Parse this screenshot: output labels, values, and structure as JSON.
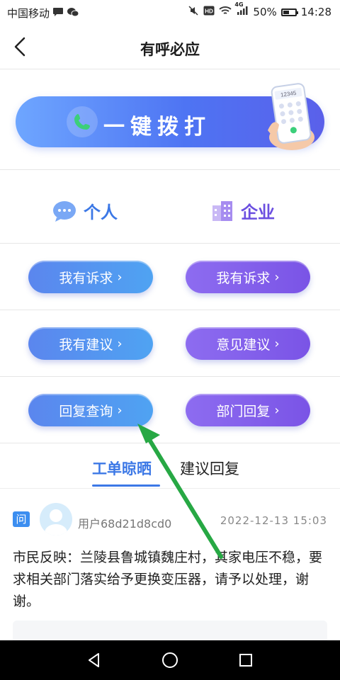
{
  "status_bar": {
    "carrier": "中国移动",
    "network": "4G",
    "battery": "50%",
    "battery_level": 0.5,
    "time": "14:28"
  },
  "header": {
    "title": "有呼必应"
  },
  "banner": {
    "label": "一键拨打",
    "phone_screen_text": "12345"
  },
  "categories": {
    "personal": "个人",
    "enterprise": "企业"
  },
  "buttons": {
    "row1": {
      "left": "我有诉求",
      "right": "我有诉求"
    },
    "row2": {
      "left": "我有建议",
      "right": "意见建议"
    },
    "row3": {
      "left": "回复查询",
      "right": "部门回复"
    },
    "chevron": "›"
  },
  "tabs": {
    "active": "工单晾晒",
    "inactive": "建议回复"
  },
  "post": {
    "badge": "问",
    "username": "用户68d21d8cd0",
    "timestamp": "2022-12-13 15:03",
    "body": "市民反映：兰陵县鲁城镇魏庄村，其家电压不稳，要求相关部门落实给予更换变压器，请予以处理，谢谢。"
  },
  "colors": {
    "accent_blue": "#3c78e6",
    "accent_purple": "#6b4fe0",
    "arrow_green": "#27a844"
  }
}
